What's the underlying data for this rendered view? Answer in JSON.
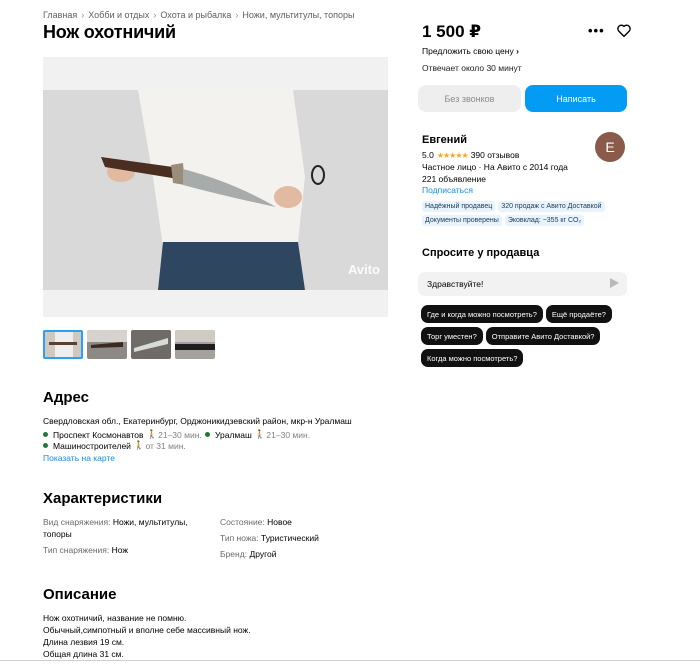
{
  "breadcrumbs": [
    "Главная",
    "Хобби и отдых",
    "Охота и рыбалка",
    "Ножи, мультитулы, топоры"
  ],
  "title": "Нож охотничий",
  "gallery": {
    "watermark": "Avito",
    "thumb_count": 4
  },
  "address": {
    "heading": "Адрес",
    "text": "Свердловская обл., Екатеринбург, Орджоникидзевский район, мкр-н Уралмаш",
    "metro": [
      {
        "name": "Проспект Космонавтов",
        "time": "21–30 мин."
      },
      {
        "name": "Уралмаш",
        "time": "21–30 мин."
      },
      {
        "name": "Машиностроителей",
        "time": "от 31 мин."
      }
    ],
    "map_link": "Показать на карте"
  },
  "characteristics": {
    "heading": "Характеристики",
    "items": [
      {
        "key": "Вид снаряжения:",
        "value": "Ножи, мультитулы, топоры"
      },
      {
        "key": "Состояние:",
        "value": "Новое"
      },
      {
        "key": "Тип снаряжения:",
        "value": "Нож"
      },
      {
        "key": "Тип ножа:",
        "value": "Туристический"
      },
      {
        "key": "Бренд:",
        "value": "Другой"
      }
    ]
  },
  "description": {
    "heading": "Описание",
    "lines": [
      "Нож охотничий, название не помню.",
      "Обычный,симпотный и вполне себе массивный нож.",
      "Длина лезвия 19 см.",
      "Общая длина 31 см."
    ]
  },
  "price": "1 500 ₽",
  "suggest_price": "Предложить свою цену",
  "respond_time": "Отвечает около 30 минут",
  "buttons": {
    "no_calls": "Без звонков",
    "write": "Написать"
  },
  "seller": {
    "name": "Евгений",
    "rating": "5.0",
    "stars": "★★★★★",
    "reviews": "390 отзывов",
    "since": "Частное лицо · На Авито с 2014 года",
    "listings": "221 объявление",
    "subscribe": "Подписаться",
    "avatar_letter": "Е",
    "badges": [
      "Надёжный продавец",
      "320 продаж с Авито Доставкой",
      "Документы проверены",
      "Эковклад: −355 кг CO₂"
    ]
  },
  "ask": {
    "heading": "Спросите у продавца",
    "input_value": "Здравствуйте!",
    "chips": [
      "Где и когда можно посмотреть?",
      "Ещё продаёте?",
      "Торг уместен?",
      "Отправите Авито Доставкой?",
      "Когда можно посмотреть?"
    ]
  },
  "icons": {
    "more": "more-icon",
    "favorite": "heart-icon",
    "send": "send-icon",
    "walk": "walk-icon",
    "chevron": "chevron-right-icon"
  }
}
